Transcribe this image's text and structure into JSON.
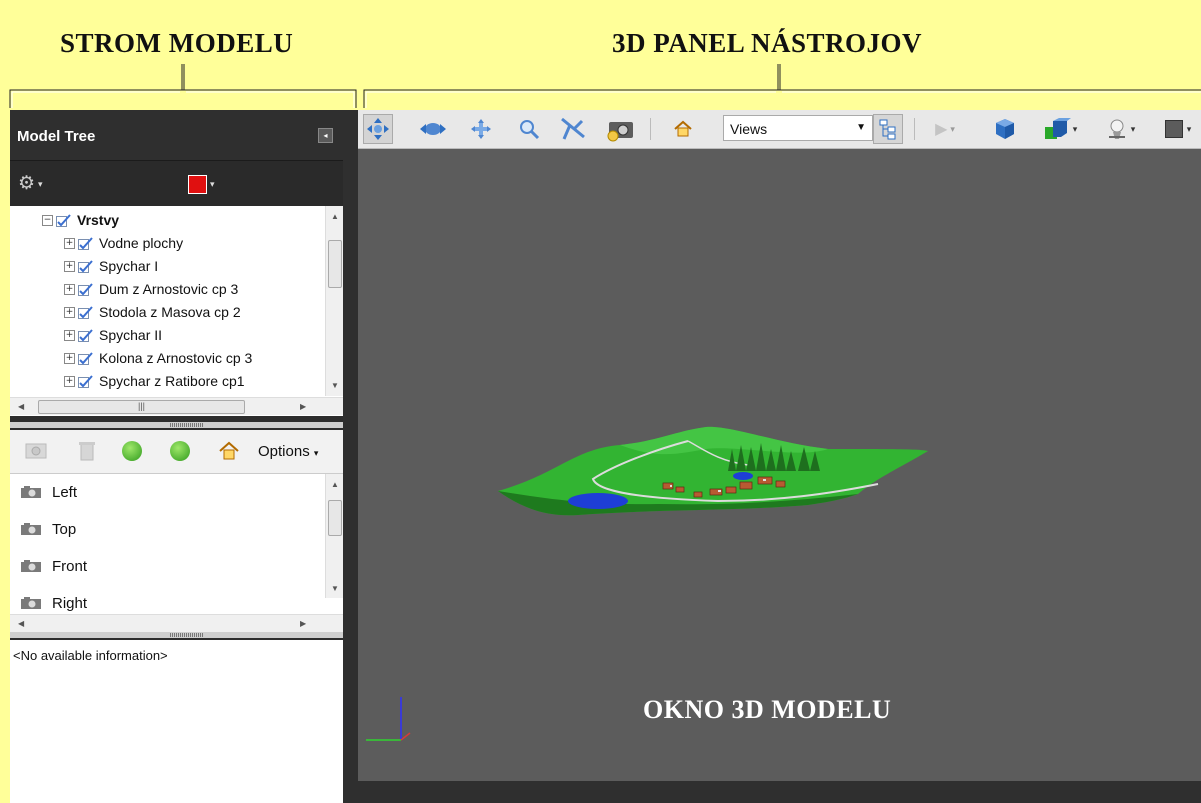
{
  "headings": {
    "model_tree": "STROM MODELU",
    "toolbar_3d": "3D PANEL NÁSTROJOV",
    "window_3d": "OKNO 3D MODELU"
  },
  "model_tree": {
    "title": "Model Tree",
    "color_swatch": "#e01010",
    "tree_items": [
      {
        "label": "Vrstvy",
        "bold": true
      },
      {
        "label": "Vodne plochy"
      },
      {
        "label": "Spychar I"
      },
      {
        "label": "Dum z Arnostovic cp 3"
      },
      {
        "label": "Stodola z Masova cp 2"
      },
      {
        "label": "Spychar II"
      },
      {
        "label": "Kolona z Arnostovic cp 3"
      },
      {
        "label": "Spychar z Ratibore cp1"
      }
    ],
    "views_options_label": "Options",
    "views": [
      "Left",
      "Top",
      "Front",
      "Right"
    ],
    "info_text": "<No available information>"
  },
  "toolbar_3d": {
    "views_dropdown": "Views",
    "icons": [
      "rotate-icon",
      "spin-icon",
      "pan-icon",
      "zoom-icon",
      "walk-icon",
      "camera-icon",
      "home-icon",
      "model-tree-toggle-icon",
      "play-icon",
      "3d-cube-icon",
      "render-mode-icon",
      "lighting-icon",
      "background-color-icon"
    ]
  }
}
